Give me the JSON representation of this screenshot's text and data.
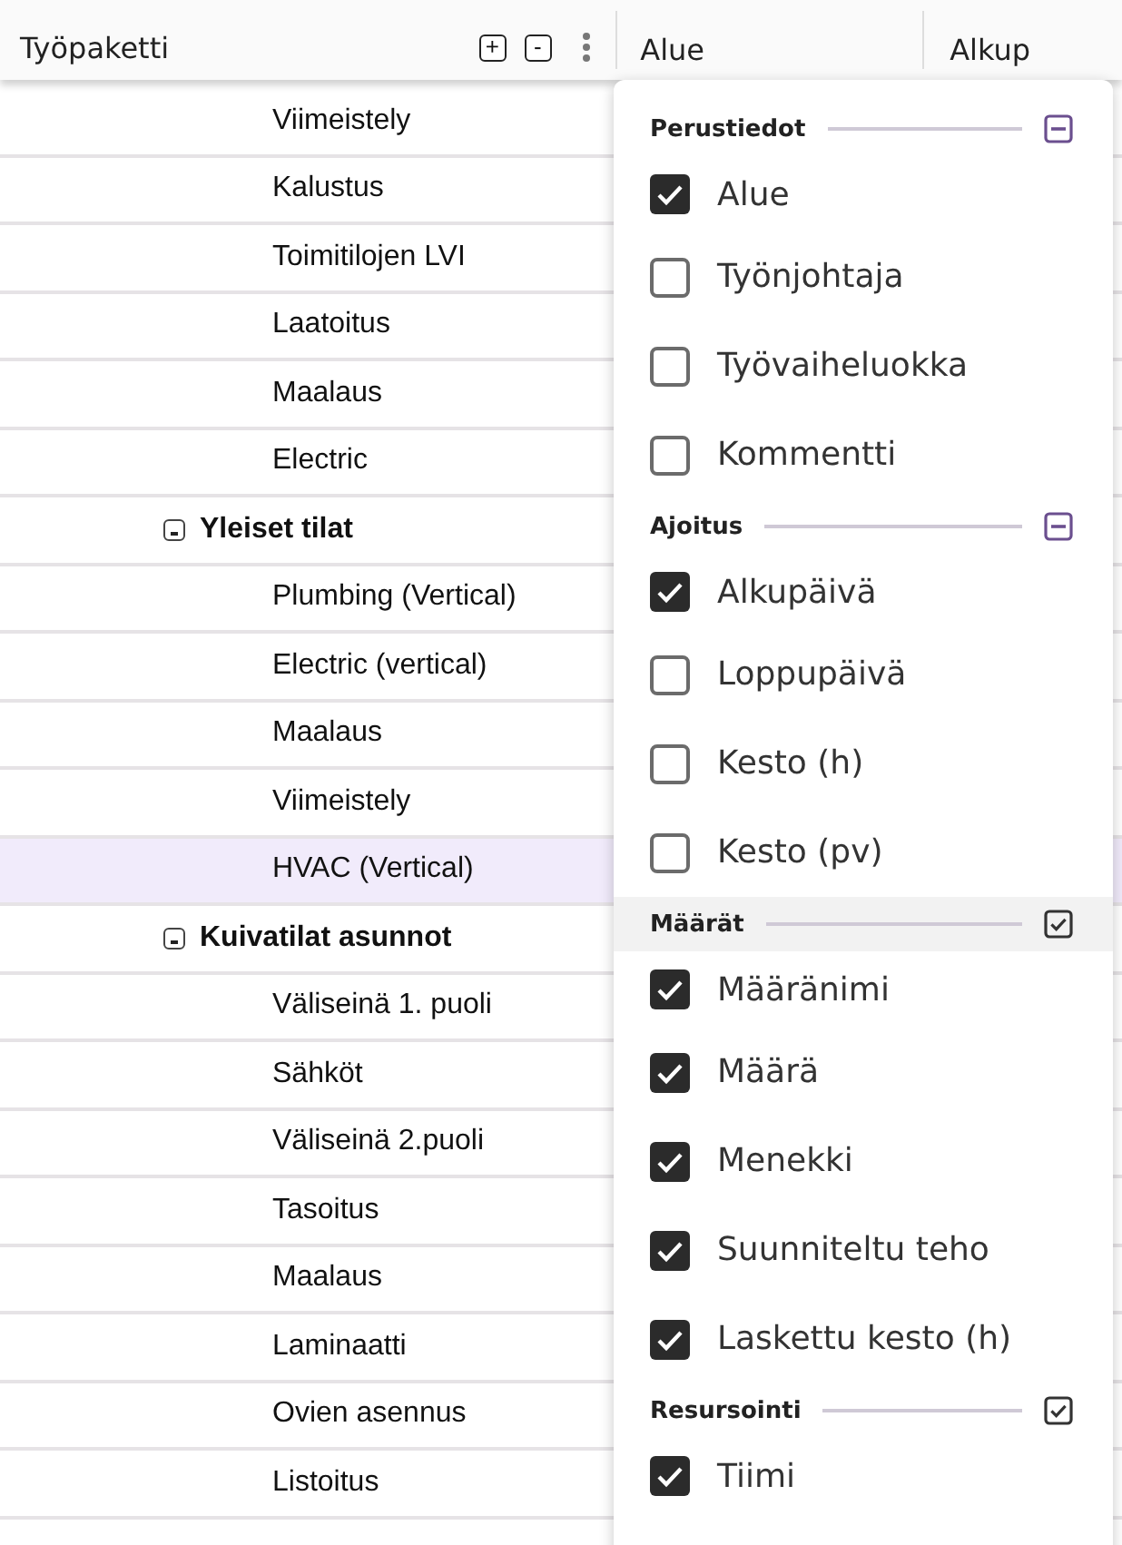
{
  "table": {
    "columns": [
      {
        "label": "Työpaketti",
        "expand_all": "+",
        "collapse_all": "-"
      },
      {
        "label": "Alue"
      },
      {
        "label": "Alkup"
      }
    ],
    "rows": [
      {
        "kind": "task",
        "label": "Viimeistely",
        "selected": false
      },
      {
        "kind": "task",
        "label": "Kalustus",
        "selected": false
      },
      {
        "kind": "task",
        "label": "Toimitilojen LVI",
        "selected": false
      },
      {
        "kind": "task",
        "label": "Laatoitus",
        "selected": false
      },
      {
        "kind": "task",
        "label": "Maalaus",
        "selected": false
      },
      {
        "kind": "task",
        "label": "Electric",
        "selected": false
      },
      {
        "kind": "group",
        "label": "Yleiset tilat",
        "expanded": true,
        "selected": false
      },
      {
        "kind": "task",
        "label": "Plumbing (Vertical)",
        "selected": false
      },
      {
        "kind": "task",
        "label": "Electric (vertical)",
        "selected": false
      },
      {
        "kind": "task",
        "label": "Maalaus",
        "selected": false
      },
      {
        "kind": "task",
        "label": "Viimeistely",
        "selected": false
      },
      {
        "kind": "task",
        "label": "HVAC (Vertical)",
        "selected": true
      },
      {
        "kind": "group",
        "label": "Kuivatilat asunnot",
        "expanded": true,
        "selected": false
      },
      {
        "kind": "task",
        "label": "Väliseinä 1. puoli",
        "selected": false
      },
      {
        "kind": "task",
        "label": "Sähköt",
        "selected": false
      },
      {
        "kind": "task",
        "label": "Väliseinä 2.puoli",
        "selected": false
      },
      {
        "kind": "task",
        "label": "Tasoitus",
        "selected": false
      },
      {
        "kind": "task",
        "label": "Maalaus",
        "selected": false
      },
      {
        "kind": "task",
        "label": "Laminaatti",
        "selected": false
      },
      {
        "kind": "task",
        "label": "Ovien asennus",
        "selected": false
      },
      {
        "kind": "task",
        "label": "Listoitus",
        "selected": false
      },
      {
        "kind": "task",
        "selected": false
      }
    ]
  },
  "column_menu": {
    "sections": [
      {
        "title": "Perustiedot",
        "all_checked": false,
        "hovered": false,
        "items": [
          {
            "label": "Alue",
            "checked": true
          },
          {
            "label": "Työnjohtaja",
            "checked": false
          },
          {
            "label": "Työvaiheluokka",
            "checked": false
          },
          {
            "label": "Kommentti",
            "checked": false
          }
        ]
      },
      {
        "title": "Ajoitus",
        "all_checked": false,
        "hovered": false,
        "items": [
          {
            "label": "Alkupäivä",
            "checked": true
          },
          {
            "label": "Loppupäivä",
            "checked": false
          },
          {
            "label": "Kesto (h)",
            "checked": false
          },
          {
            "label": "Kesto (pv)",
            "checked": false
          }
        ]
      },
      {
        "title": "Määrät",
        "all_checked": true,
        "hovered": true,
        "items": [
          {
            "label": "Määränimi",
            "checked": true
          },
          {
            "label": "Määrä",
            "checked": true
          },
          {
            "label": "Menekki",
            "checked": true
          },
          {
            "label": "Suunniteltu teho",
            "checked": true
          },
          {
            "label": "Laskettu kesto (h)",
            "checked": true
          }
        ]
      },
      {
        "title": "Resursointi",
        "all_checked": true,
        "hovered": false,
        "items": [
          {
            "label": "Tiimi",
            "checked": true
          }
        ]
      }
    ]
  }
}
